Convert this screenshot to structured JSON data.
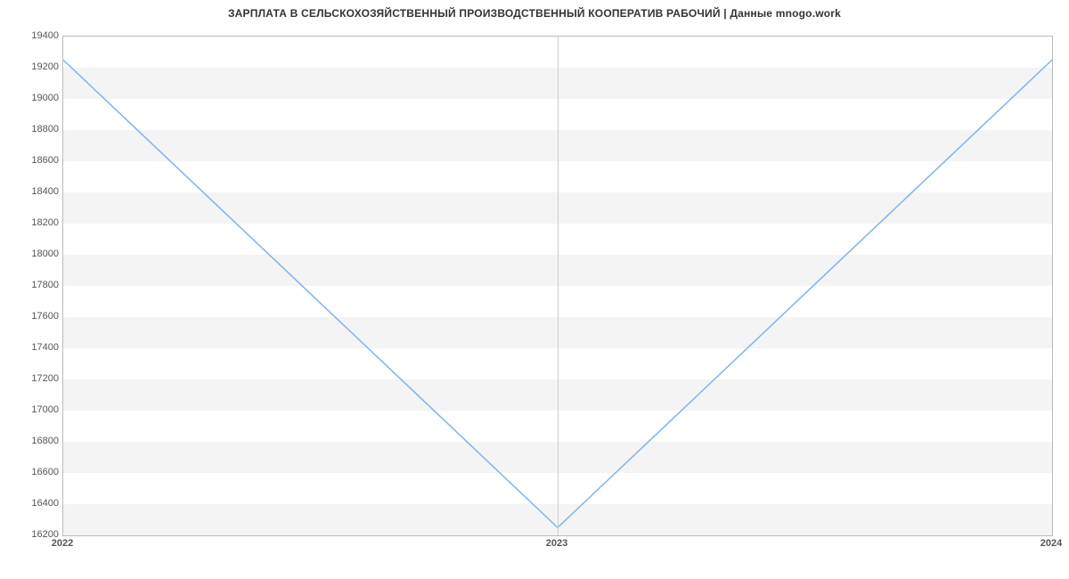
{
  "chart_data": {
    "type": "line",
    "title": "ЗАРПЛАТА В СЕЛЬСКОХОЗЯЙСТВЕННЫЙ ПРОИЗВОДСТВЕННЫЙ КООПЕРАТИВ РАБОЧИЙ | Данные mnogo.work",
    "x": [
      2022,
      2023,
      2024
    ],
    "x_ticks": [
      "2022",
      "2023",
      "2024"
    ],
    "values": [
      19250,
      16250,
      19250
    ],
    "y_ticks": [
      16200,
      16400,
      16600,
      16800,
      17000,
      17200,
      17400,
      17600,
      17800,
      18000,
      18200,
      18400,
      18600,
      18800,
      19000,
      19200,
      19400
    ],
    "ylim": [
      16200,
      19400
    ],
    "line_color": "#7cb5ec"
  }
}
